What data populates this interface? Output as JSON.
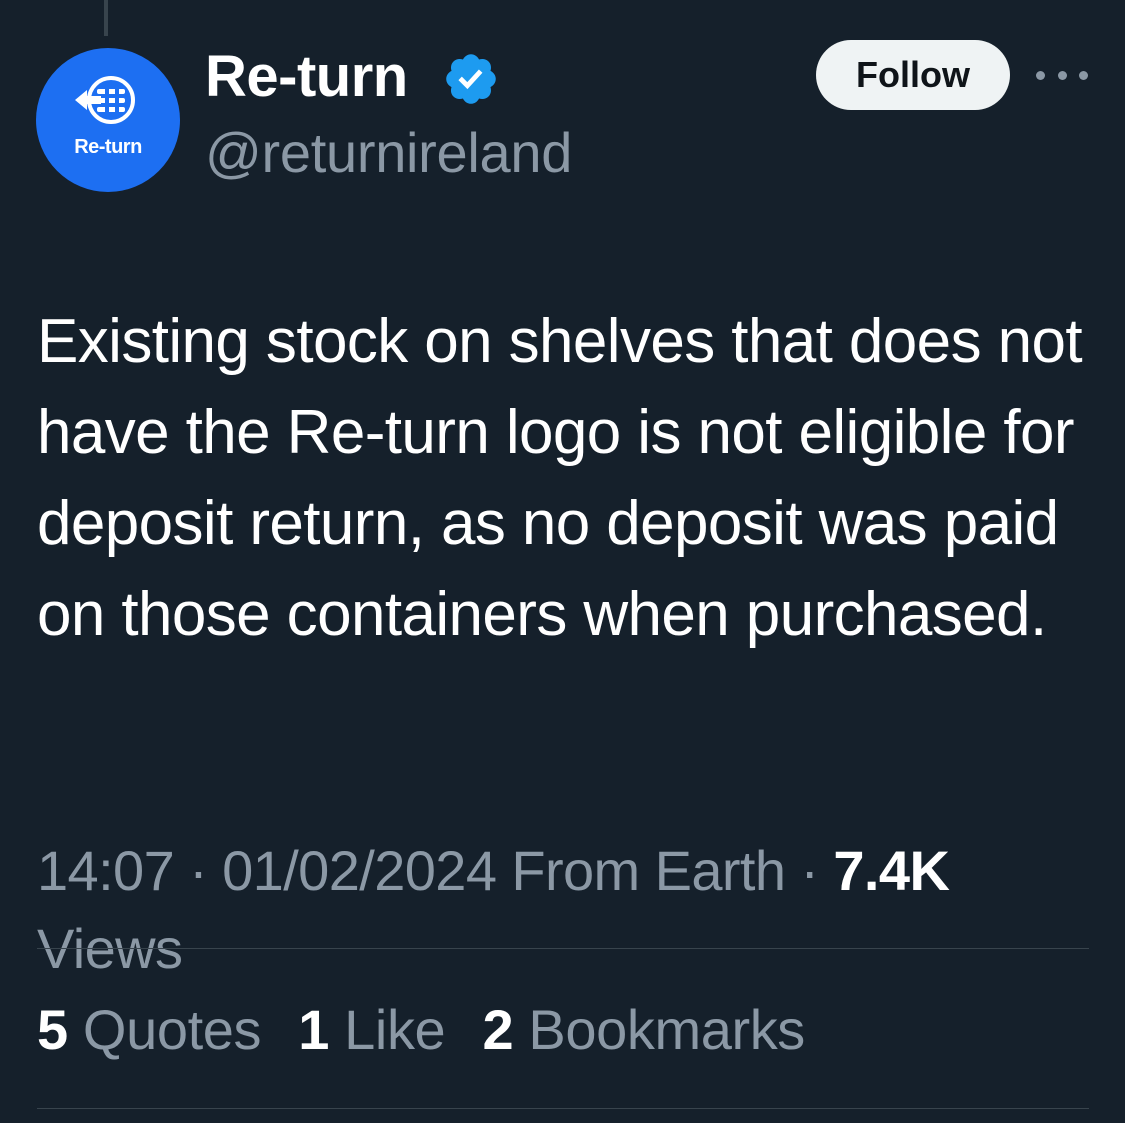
{
  "author": {
    "display_name": "Re-turn",
    "handle": "@returnireland",
    "avatar_text": "Re-turn",
    "verified": true,
    "verified_color": "#1d9bf0",
    "avatar_color": "#1d6ff2"
  },
  "actions": {
    "follow_label": "Follow",
    "more_icon": "more-horizontal-icon"
  },
  "tweet": {
    "text": "Existing stock on shelves that does not have the Re-turn logo is not eligible for deposit return, as no deposit was paid on those containers when purchased."
  },
  "meta": {
    "time": "14:07",
    "separator": " · ",
    "date": "01/02/2024",
    "source": "From Earth",
    "views_count": "7.4K",
    "views_label": "Views"
  },
  "stats": [
    {
      "count": "5",
      "label": "Quotes"
    },
    {
      "count": "1",
      "label": "Like"
    },
    {
      "count": "2",
      "label": "Bookmarks"
    }
  ],
  "colors": {
    "background": "#15202b",
    "secondary_text": "#8b98a5",
    "divider": "#38444d",
    "follow_bg": "#eff3f4"
  }
}
